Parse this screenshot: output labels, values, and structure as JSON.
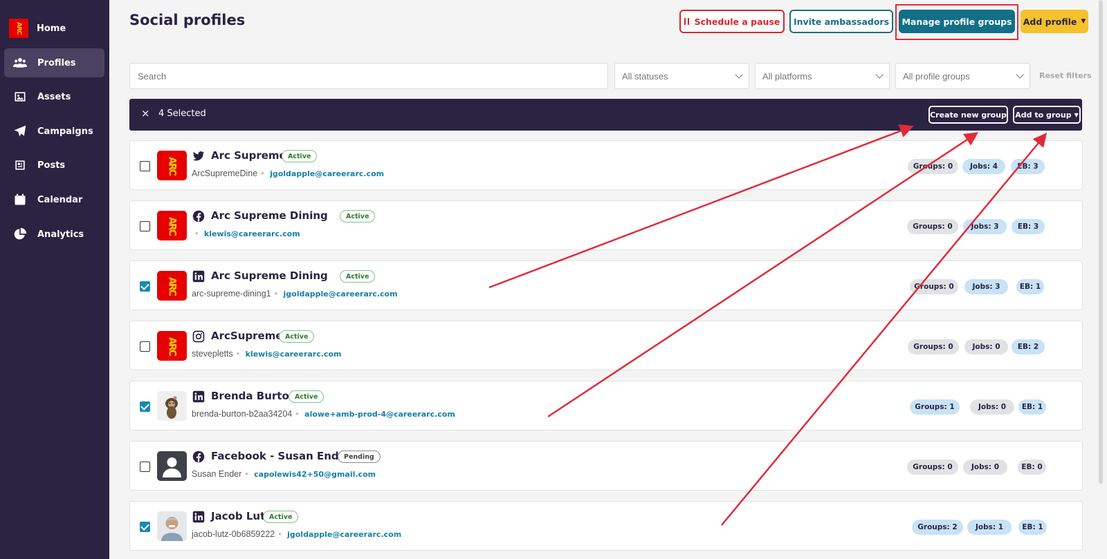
{
  "sidebar": {
    "items": [
      {
        "label": "Home",
        "icon": "arc-logo"
      },
      {
        "label": "Profiles",
        "icon": "users-icon"
      },
      {
        "label": "Assets",
        "icon": "image-icon"
      },
      {
        "label": "Campaigns",
        "icon": "paper-plane-icon"
      },
      {
        "label": "Posts",
        "icon": "newspaper-icon"
      },
      {
        "label": "Calendar",
        "icon": "calendar-icon"
      },
      {
        "label": "Analytics",
        "icon": "pie-chart-icon"
      }
    ],
    "logo_text": "ARC"
  },
  "header": {
    "title": "Social profiles",
    "schedule_pause": "Schedule a pause",
    "invite": "Invite ambassadors",
    "manage_groups": "Manage profile groups",
    "add_profile": "Add profile"
  },
  "filters": {
    "search_placeholder": "Search",
    "statuses": "All statuses",
    "platforms": "All platforms",
    "groups": "All profile groups",
    "reset": "Reset filters"
  },
  "selection": {
    "close": "×",
    "count": "4 Selected",
    "create_group": "Create new group",
    "add_to_group": "Add to group"
  },
  "rows": [
    {
      "platform": "twitter",
      "name": "Arc Supreme",
      "status": "Active",
      "handle": "ArcSupremeDine",
      "email": "jgoldapple@careerarc.com",
      "groups": "Groups: 0",
      "jobs": "Jobs: 4",
      "eb": "EB: 3",
      "checked": false,
      "avatar": "ARC"
    },
    {
      "platform": "facebook",
      "name": "Arc Supreme Dining",
      "status": "Active",
      "handle": "",
      "email": "klewis@careerarc.com",
      "groups": "Groups: 0",
      "jobs": "Jobs: 3",
      "eb": "EB: 3",
      "checked": false,
      "avatar": "ARC"
    },
    {
      "platform": "linkedin",
      "name": "Arc Supreme Dining",
      "status": "Active",
      "handle": "arc-supreme-dining1",
      "email": "jgoldapple@careerarc.com",
      "groups": "Groups: 0",
      "jobs": "Jobs: 3",
      "eb": "EB: 1",
      "checked": true,
      "avatar": "ARC"
    },
    {
      "platform": "instagram",
      "name": "ArcSupreme",
      "status": "Active",
      "handle": "stevepletts",
      "email": "klewis@careerarc.com",
      "groups": "Groups: 0",
      "jobs": "Jobs: 0",
      "eb": "EB: 2",
      "checked": false,
      "avatar": "ARC"
    },
    {
      "platform": "linkedin",
      "name": "Brenda Burton",
      "status": "Active",
      "handle": "brenda-burton-b2aa34204",
      "email": "alowe+amb-prod-4@careerarc.com",
      "groups": "Groups: 1",
      "jobs": "Jobs: 0",
      "eb": "EB: 1",
      "checked": true,
      "avatar": ""
    },
    {
      "platform": "facebook",
      "name": "Facebook - Susan Ender",
      "status": "Pending",
      "handle": "Susan Ender",
      "email": "capolewis42+50@gmail.com",
      "groups": "Groups: 0",
      "jobs": "Jobs: 0",
      "eb": "EB: 0",
      "checked": false,
      "avatar": ""
    },
    {
      "platform": "linkedin",
      "name": "Jacob Lutz",
      "status": "Active",
      "handle": "jacob-lutz-0b6859222",
      "email": "jgoldapple@careerarc.com",
      "groups": "Groups: 2",
      "jobs": "Jobs: 1",
      "eb": "EB: 1",
      "checked": true,
      "avatar": ""
    }
  ],
  "colors": {
    "sidebar_bg": "#2b2342",
    "primary": "#136f87",
    "accent_yellow": "#f5c12c",
    "danger": "#d8262d",
    "highlight_arrow": "#e02b3a"
  }
}
